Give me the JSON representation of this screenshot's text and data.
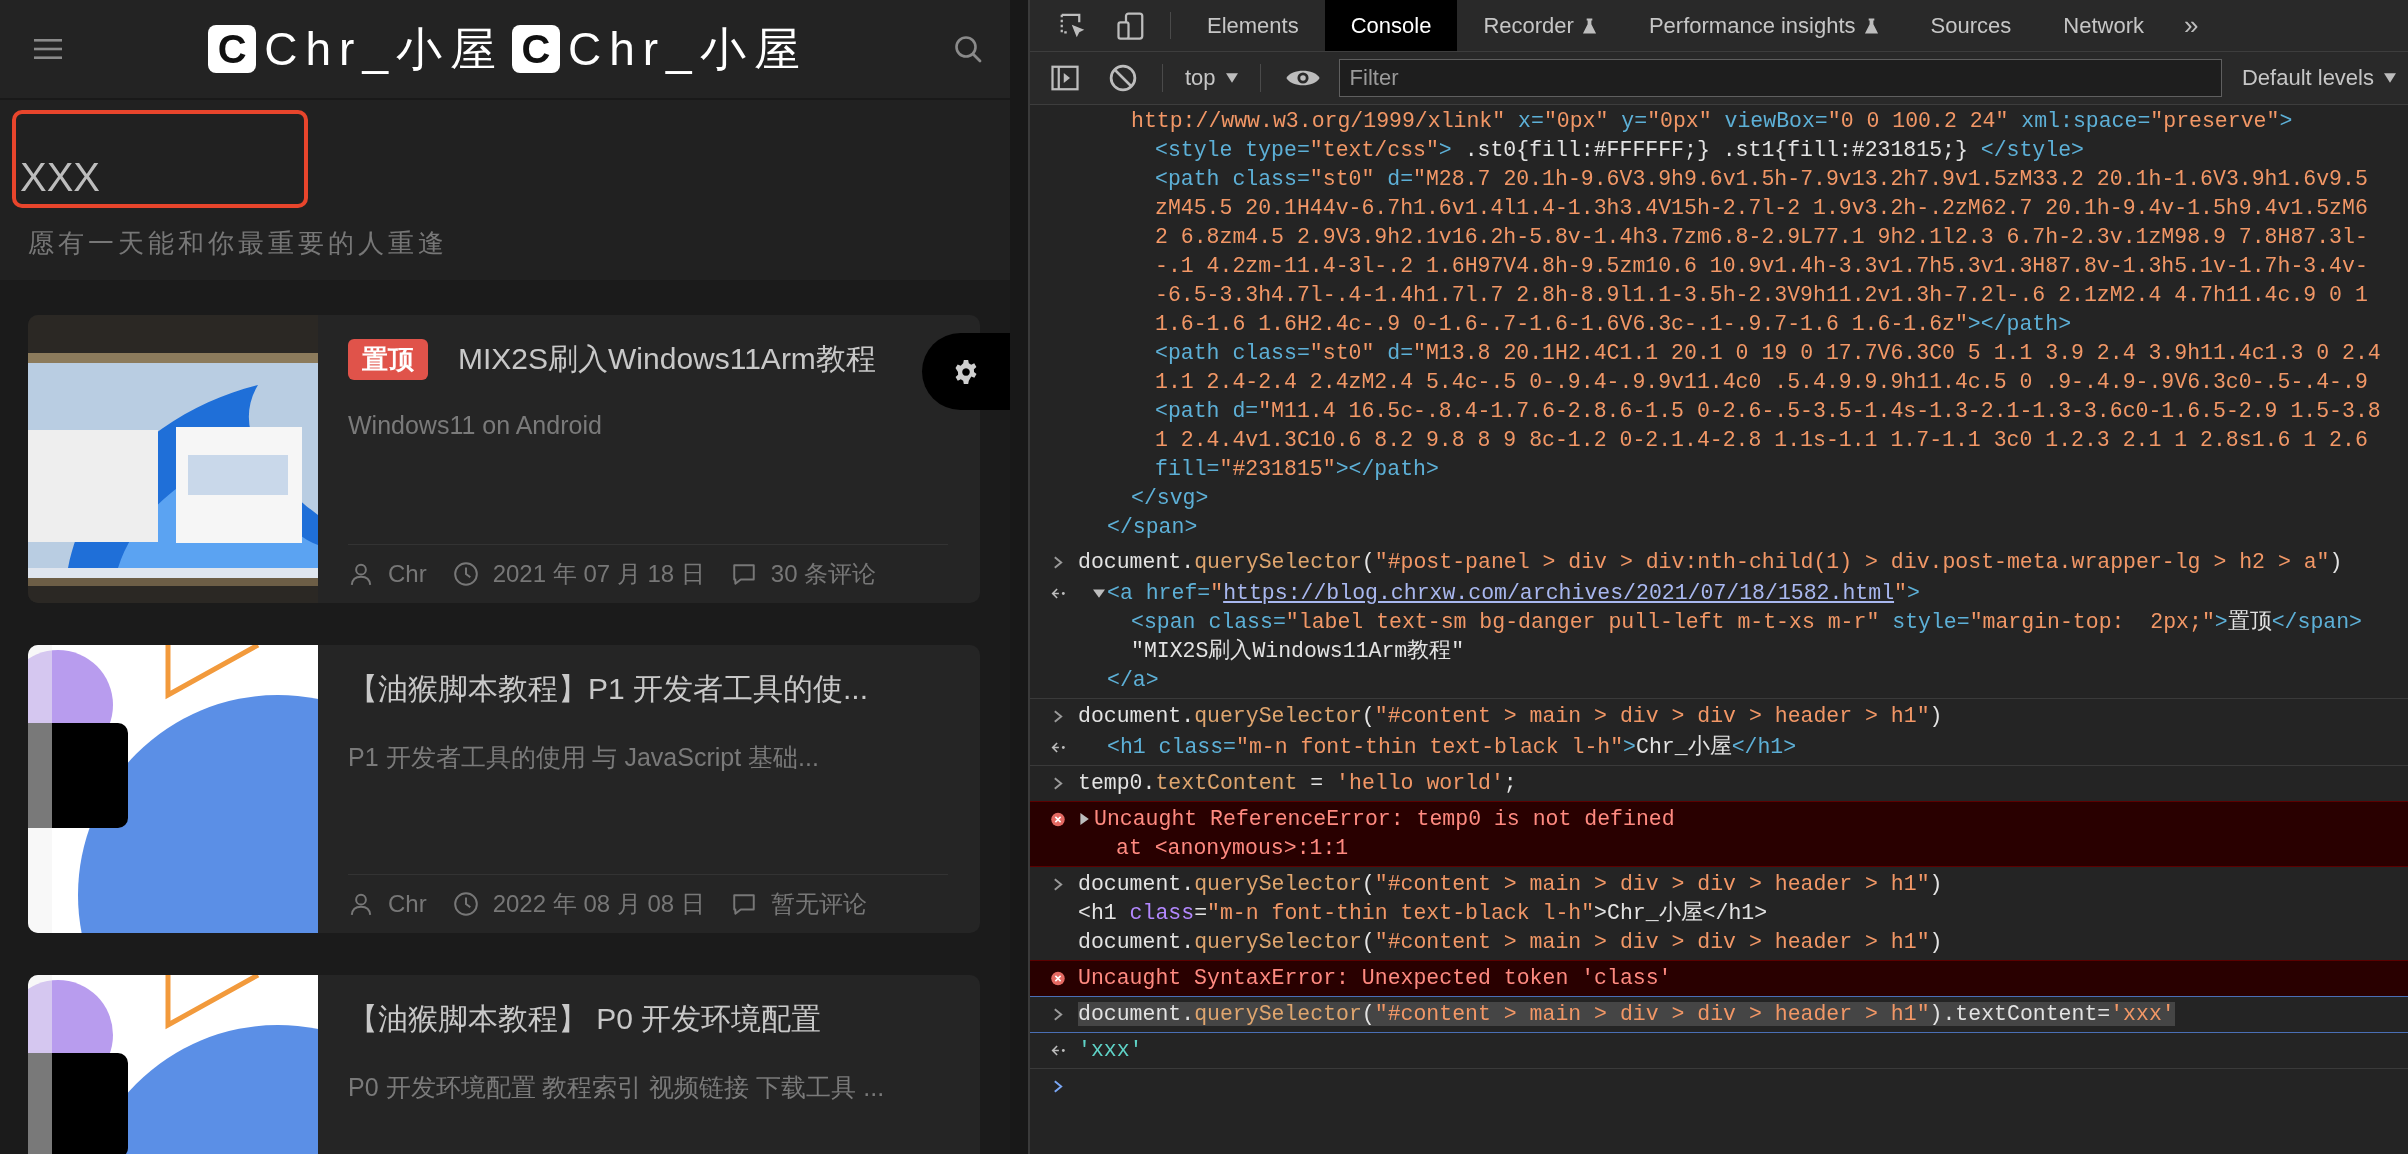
{
  "blog": {
    "logo": [
      {
        "badge": "C",
        "text": "Chr_小屋"
      },
      {
        "badge": "C",
        "text": "Chr_小屋"
      }
    ],
    "site": {
      "title": "XXX",
      "tagline": "愿有一天能和你最重要的人重逢"
    },
    "posts": [
      {
        "badge": "置顶",
        "title": "MIX2S刷入Windows11Arm教程",
        "excerpt": "Windows11 on Android",
        "meta": {
          "author": "Chr",
          "date": "2021 年 07 月 18 日",
          "comments": "30 条评论"
        }
      },
      {
        "title": "【油猴脚本教程】P1 开发者工具的使...",
        "excerpt": "P1 开发者工具的使用 与 JavaScript 基础...",
        "meta": {
          "author": "Chr",
          "date": "2022 年 08 月 08 日",
          "comments": "暂无评论"
        }
      },
      {
        "title": "【油猴脚本教程】 P0 开发环境配置",
        "excerpt": "P0 开发环境配置 教程索引 视频链接 下载工具 ..."
      }
    ]
  },
  "devtools": {
    "tabs": [
      {
        "label": "Elements",
        "selected": false,
        "experimental": false
      },
      {
        "label": "Console",
        "selected": true,
        "experimental": false
      },
      {
        "label": "Recorder",
        "selected": false,
        "experimental": true
      },
      {
        "label": "Performance insights",
        "selected": false,
        "experimental": true
      },
      {
        "label": "Sources",
        "selected": false,
        "experimental": false
      },
      {
        "label": "Network",
        "selected": false,
        "experimental": false
      }
    ],
    "more_tabs": "»",
    "context": "top",
    "filter_placeholder": "Filter",
    "levels": "Default levels"
  },
  "console": {
    "entries": [
      {
        "kind": "fragment",
        "nodes": [
          {
            "close": [
              [
                {
                  "kind": "tag",
                  "text": "</span>"
                }
              ]
            ],
            "children": [
              {
                "open": [
                  [
                    {
                      "kind": "val",
                      "text": "http://www.w3.org/1999/xlink\""
                    },
                    {
                      "kind": "tag",
                      "text": " x="
                    },
                    {
                      "kind": "val",
                      "text": "\"0px\""
                    },
                    {
                      "kind": "tag",
                      "text": " y="
                    },
                    {
                      "kind": "val",
                      "text": "\"0px\""
                    },
                    {
                      "kind": "tag",
                      "text": " viewBox="
                    },
                    {
                      "kind": "val",
                      "text": "\"0 0 100.2 24\""
                    },
                    {
                      "kind": "tag",
                      "text": " xml:space="
                    },
                    {
                      "kind": "val",
                      "text": "\"preserve\""
                    },
                    {
                      "kind": "tag",
                      "text": ">"
                    }
                  ]
                ],
                "close": [
                  [
                    {
                      "kind": "tag",
                      "text": "</svg>"
                    }
                  ]
                ],
                "children": [
                  {
                    "open": [
                      [
                        {
                          "kind": "tag",
                          "text": "<style type="
                        },
                        {
                          "kind": "val",
                          "text": "\"text/css\""
                        },
                        {
                          "kind": "tag",
                          "text": ">"
                        },
                        {
                          "kind": "plain",
                          "text": " .st0{fill:#FFFFFF;} .st1{fill:#231815;} "
                        },
                        {
                          "kind": "tag",
                          "text": "</style>"
                        }
                      ]
                    ]
                  },
                  {
                    "open": [
                      [
                        {
                          "kind": "tag",
                          "text": "<path class="
                        },
                        {
                          "kind": "val",
                          "text": "\"st0\""
                        },
                        {
                          "kind": "tag",
                          "text": " d="
                        },
                        {
                          "kind": "val",
                          "text": "\"M28.7 20.1h-9.6V3.9h9.6v1.5h-7.9v13.2h7.9v1.5zM33.2 20.1h-1.6V3.9h1.6v9.5"
                        }
                      ],
                      [
                        {
                          "kind": "val",
                          "text": "zM45.5 20.1H44v-6.7h1.6v1.4l1.4-1.3h3.4V15h-2.7l-2 1.9v3.2h-.2zM62.7 20.1h-9.4v-1.5h9.4v1.5zM6"
                        }
                      ],
                      [
                        {
                          "kind": "val",
                          "text": "2 6.8zm4.5 2.9V3.9h2.1v16.2h-5.8v-1.4h3.7zm6.8-2.9L77.1 9h2.1l2.3 6.7h-2.3v.1zM98.9 7.8H87.3l-"
                        }
                      ],
                      [
                        {
                          "kind": "val",
                          "text": "-.1 4.2zm-11.4-3l-.2 1.6H97V4.8h-9.5zm10.6 10.9v1.4h-3.3v1.7h5.3v1.3H87.8v-1.3h5.1v-1.7h-3.4v-"
                        }
                      ],
                      [
                        {
                          "kind": "val",
                          "text": "-6.5-3.3h4.7l-.4-1.4h1.7l.7 2.8h-8.9l1.1-3.5h-2.3V9h11.2v1.3h-7.2l-.6 2.1zM2.4 4.7h11.4c.9 0 1"
                        }
                      ],
                      [
                        {
                          "kind": "val",
                          "text": "1.6-1.6 1.6H2.4c-.9 0-1.6-.7-1.6-1.6V6.3c-.1-.9.7-1.6 1.6-1.6z\""
                        },
                        {
                          "kind": "tag",
                          "text": "></path>"
                        }
                      ]
                    ]
                  },
                  {
                    "open": [
                      [
                        {
                          "kind": "tag",
                          "text": "<path class="
                        },
                        {
                          "kind": "val",
                          "text": "\"st0\""
                        },
                        {
                          "kind": "tag",
                          "text": " d="
                        },
                        {
                          "kind": "val",
                          "text": "\"M13.8 20.1H2.4C1.1 20.1 0 19 0 17.7V6.3C0 5 1.1 3.9 2.4 3.9h11.4c1.3 0 2.4"
                        }
                      ],
                      [
                        {
                          "kind": "val",
                          "text": "1.1 2.4-2.4 2.4zM2.4 5.4c-.5 0-.9.4-.9.9v11.4c0 .5.4.9.9.9h11.4c.5 0 .9-.4.9-.9V6.3c0-.5-.4-.9"
                        }
                      ]
                    ]
                  },
                  {
                    "open": [
                      [
                        {
                          "kind": "tag",
                          "text": "<path d="
                        },
                        {
                          "kind": "val",
                          "text": "\"M11.4 16.5c-.8.4-1.7.6-2.8.6-1.5 0-2.6-.5-3.5-1.4s-1.3-2.1-1.3-3.6c0-1.6.5-2.9 1.5-3.8"
                        }
                      ],
                      [
                        {
                          "kind": "val",
                          "text": "1 2.4.4v1.3C10.6 8.2 9.8 8 9 8c-1.2 0-2.1.4-2.8 1.1s-1.1 1.7-1.1 3c0 1.2.3 2.1 1 2.8s1.6 1 2.6"
                        }
                      ],
                      [
                        {
                          "kind": "tag",
                          "text": "fill="
                        },
                        {
                          "kind": "val",
                          "text": "\"#231815\""
                        },
                        {
                          "kind": "tag",
                          "text": "></path>"
                        }
                      ]
                    ]
                  }
                ]
              }
            ]
          }
        ]
      },
      {
        "kind": "input",
        "lines": [
          [
            {
              "kind": "plain",
              "text": "document."
            },
            {
              "kind": "method",
              "text": "querySelector"
            },
            {
              "kind": "plain",
              "text": "("
            },
            {
              "kind": "str",
              "text": "\"#post-panel > div > div:nth-child(1) > div.post-meta.wrapper-lg > h2 > a\""
            },
            {
              "kind": "plain",
              "text": ")"
            }
          ]
        ]
      },
      {
        "kind": "output",
        "nodes": [
          {
            "expanded": true,
            "open": [
              [
                {
                  "kind": "tag",
                  "text": "<a href="
                },
                {
                  "kind": "val",
                  "text": "\""
                },
                {
                  "kind": "url",
                  "text": "https://blog.chrxw.com/archives/2021/07/18/1582.html"
                },
                {
                  "kind": "val",
                  "text": "\""
                },
                {
                  "kind": "tag",
                  "text": ">"
                }
              ]
            ],
            "close": [
              [
                {
                  "kind": "tag",
                  "text": "</a>"
                }
              ]
            ],
            "children": [
              {
                "open": [
                  [
                    {
                      "kind": "tag",
                      "text": "<span class="
                    },
                    {
                      "kind": "val",
                      "text": "\"label text-sm bg-danger pull-left m-t-xs m-r\""
                    },
                    {
                      "kind": "tag",
                      "text": " style="
                    },
                    {
                      "kind": "val",
                      "text": "\"margin-top:  2px;\""
                    },
                    {
                      "kind": "tag",
                      "text": ">"
                    },
                    {
                      "kind": "plain",
                      "text": "置顶"
                    },
                    {
                      "kind": "tag",
                      "text": "</span>"
                    }
                  ]
                ]
              },
              {
                "open": [
                  [
                    {
                      "kind": "plain",
                      "text": "\"MIX2S刷入Windows11Arm教程\""
                    }
                  ]
                ]
              }
            ]
          }
        ]
      },
      {
        "kind": "input",
        "lines": [
          [
            {
              "kind": "plain",
              "text": "document."
            },
            {
              "kind": "method",
              "text": "querySelector"
            },
            {
              "kind": "plain",
              "text": "("
            },
            {
              "kind": "str",
              "text": "\"#content > main > div > div > header > h1\""
            },
            {
              "kind": "plain",
              "text": ")"
            }
          ]
        ]
      },
      {
        "kind": "output",
        "nodes": [
          {
            "open": [
              [
                {
                  "kind": "tag",
                  "text": "<h1 class="
                },
                {
                  "kind": "val",
                  "text": "\"m-n font-thin text-black l-h\""
                },
                {
                  "kind": "tag",
                  "text": ">"
                },
                {
                  "kind": "plain",
                  "text": "Chr_小屋"
                },
                {
                  "kind": "tag",
                  "text": "</h1>"
                }
              ]
            ]
          }
        ]
      },
      {
        "kind": "input",
        "lines": [
          [
            {
              "kind": "plain",
              "text": "temp0."
            },
            {
              "kind": "method",
              "text": "textContent"
            },
            {
              "kind": "plain",
              "text": " = "
            },
            {
              "kind": "str",
              "text": "'hello world'"
            },
            {
              "kind": "plain",
              "text": ";"
            }
          ]
        ]
      },
      {
        "kind": "error",
        "expanded": false,
        "lines": [
          "Uncaught ReferenceError: temp0 is not defined",
          "at <anonymous>:1:1"
        ]
      },
      {
        "kind": "input",
        "lines": [
          [
            {
              "kind": "plain",
              "text": "document."
            },
            {
              "kind": "method",
              "text": "querySelector"
            },
            {
              "kind": "plain",
              "text": "("
            },
            {
              "kind": "str",
              "text": "\"#content > main > div > div > header > h1\""
            },
            {
              "kind": "plain",
              "text": ")"
            }
          ],
          [
            {
              "kind": "plain",
              "text": "<h1 "
            },
            {
              "kind": "prop",
              "text": "class"
            },
            {
              "kind": "plain",
              "text": "="
            },
            {
              "kind": "str",
              "text": "\"m-n font-thin text-black l-h\""
            },
            {
              "kind": "plain",
              "text": ">Chr_小屋</h1>"
            }
          ],
          [
            {
              "kind": "plain",
              "text": "document."
            },
            {
              "kind": "method",
              "text": "querySelector"
            },
            {
              "kind": "plain",
              "text": "("
            },
            {
              "kind": "str",
              "text": "\"#content > main > div > div > header > h1\""
            },
            {
              "kind": "plain",
              "text": ")"
            }
          ]
        ]
      },
      {
        "kind": "error",
        "lines": [
          "Uncaught SyntaxError: Unexpected token 'class'"
        ]
      },
      {
        "kind": "input",
        "selected": true,
        "lines": [
          [
            {
              "kind": "plain",
              "text": "document."
            },
            {
              "kind": "method",
              "text": "querySelector"
            },
            {
              "kind": "plain",
              "text": "("
            },
            {
              "kind": "str",
              "text": "\"#content > main > div > div > header > h1\""
            },
            {
              "kind": "plain",
              "text": ").textContent="
            },
            {
              "kind": "str",
              "text": "'xxx'"
            }
          ]
        ]
      },
      {
        "kind": "value",
        "text": "'xxx'"
      },
      {
        "kind": "prompt"
      }
    ]
  }
}
